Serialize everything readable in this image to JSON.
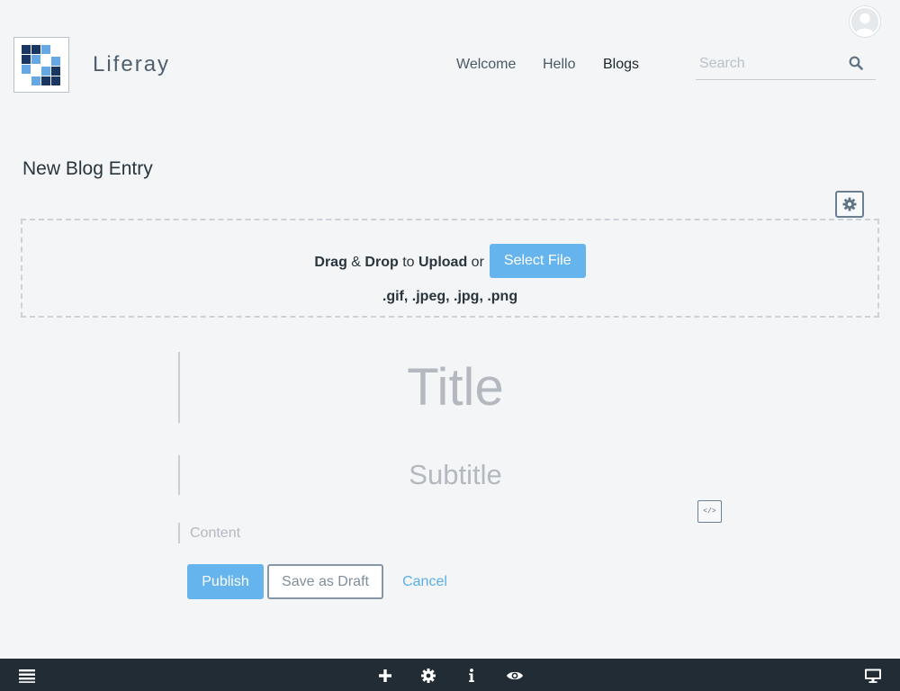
{
  "header": {
    "site_name": "Liferay",
    "nav": [
      {
        "label": "Welcome",
        "active": false
      },
      {
        "label": "Hello",
        "active": false
      },
      {
        "label": "Blogs",
        "active": true
      }
    ],
    "search": {
      "placeholder": "Search",
      "value": ""
    },
    "icons": {
      "avatar": "user-avatar-icon",
      "search": "search-icon",
      "logo": "liferay-logo"
    }
  },
  "page": {
    "title": "New Blog Entry",
    "settings_icon": "gear-icon"
  },
  "dropzone": {
    "drag": "Drag",
    "amp": "&",
    "drop": "Drop",
    "to": "to",
    "upload": "Upload",
    "or": "or",
    "select_file": "Select File",
    "file_types": ".gif, .jpeg, .jpg, .png"
  },
  "editor": {
    "title_placeholder": "Title",
    "subtitle_placeholder": "Subtitle",
    "content_placeholder": "Content",
    "source_button": "</>"
  },
  "actions": {
    "publish": "Publish",
    "save_draft": "Save as Draft",
    "cancel": "Cancel"
  },
  "toolbar": {
    "icons": [
      "menu-icon",
      "add-icon",
      "gear-icon",
      "info-icon",
      "eye-icon",
      "desktop-icon"
    ]
  },
  "colors": {
    "primary": "#65b4ee",
    "link": "#5aaee8",
    "toolbar_bg": "#222c34",
    "page_bg": "#f3f5f7"
  }
}
